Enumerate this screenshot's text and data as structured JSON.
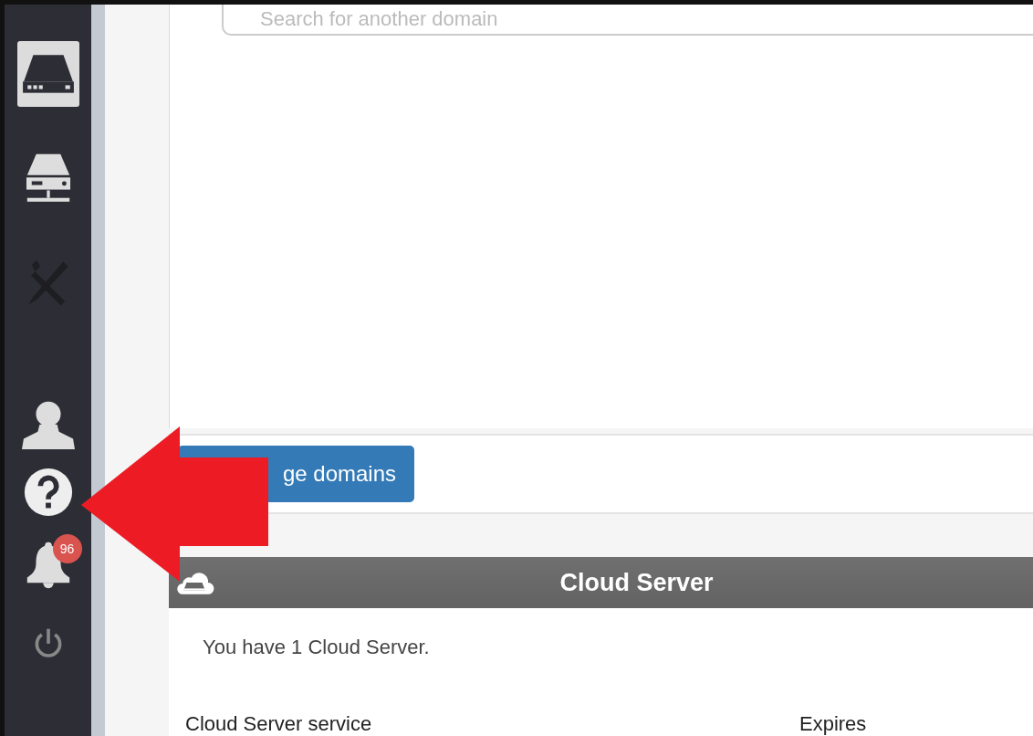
{
  "sidebar": {
    "items": [
      {
        "kind": "server",
        "selected": true,
        "disabled": false
      },
      {
        "kind": "network-server",
        "selected": false,
        "disabled": false
      },
      {
        "kind": "tools",
        "selected": false,
        "disabled": true
      },
      {
        "kind": "user",
        "selected": false,
        "disabled": false
      },
      {
        "kind": "help",
        "selected": false,
        "disabled": false
      },
      {
        "kind": "bell",
        "selected": false,
        "disabled": false,
        "badge": "96"
      },
      {
        "kind": "power",
        "selected": false,
        "disabled": false
      }
    ]
  },
  "search": {
    "placeholder": "Search for another domain"
  },
  "domains_button": {
    "label": "ge domains"
  },
  "panel": {
    "title": "Cloud Server",
    "message": "You have 1 Cloud Server.",
    "columns": [
      "Cloud Server service",
      "Expires"
    ]
  }
}
